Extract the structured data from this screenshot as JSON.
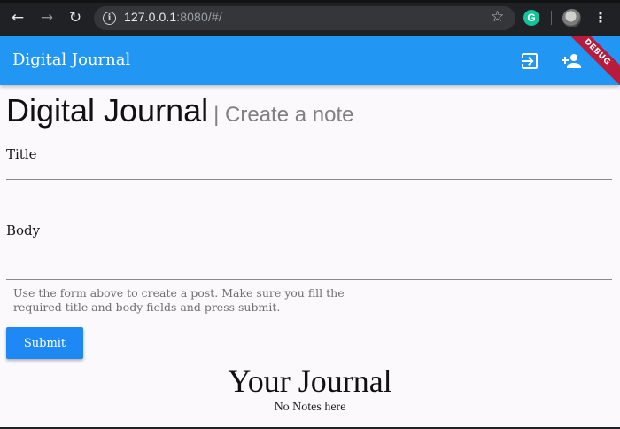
{
  "browser": {
    "url_host": "127.0.0.1",
    "url_rest": ":8080/#/",
    "icons": {
      "back": "arrow-left-icon",
      "forward": "arrow-right-icon",
      "reload": "reload-icon",
      "info": "info-icon",
      "bookmark": "star-icon",
      "extension": "grammarly-icon",
      "menu": "kebab-menu-icon"
    },
    "extension_letter": "G"
  },
  "appbar": {
    "title": "Digital Journal",
    "color": "#2196f3",
    "actions": [
      "login-icon",
      "person-add-icon"
    ],
    "debug_banner": "DEBUG"
  },
  "page": {
    "heading": "Digital Journal",
    "subheading": "| Create a note"
  },
  "form": {
    "title_label": "Title",
    "title_value": "",
    "body_label": "Body",
    "body_value": "",
    "helper": "Use the form above to create a post. Make sure you fill the required title and body fields and press submit.",
    "submit_label": "Submit",
    "submit_color": "#1e88f5"
  },
  "journal": {
    "title": "Your Journal",
    "empty_message": "No Notes here"
  }
}
